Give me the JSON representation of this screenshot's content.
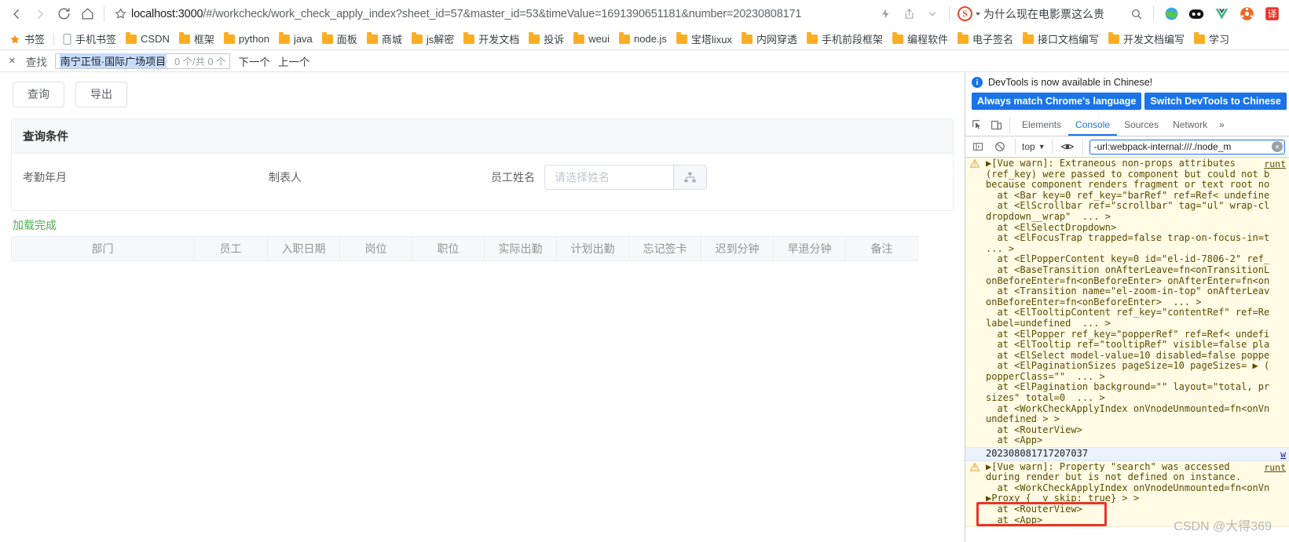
{
  "browser": {
    "url_host": "localhost:3000",
    "url_path": "/#/workcheck/work_check_apply_index?sheet_id=57&master_id=53&timeValue=1691390651181&number=20230808171",
    "search_engine_badge": "S",
    "search_query": "为什么现在电影票这么贵",
    "icons": {
      "back": "back-arrow-icon",
      "forward": "forward-arrow-icon",
      "reload": "reload-icon",
      "home": "home-icon",
      "bookmark_star": "star-icon",
      "lightning": "lightning-icon",
      "share": "share-icon",
      "chevron": "chevron-down-icon",
      "search": "search-icon"
    }
  },
  "bookmarks": {
    "star_label": "书签",
    "mobile_label": "手机书签",
    "folders": [
      "CSDN",
      "框架",
      "python",
      "java",
      "面板",
      "商城",
      "js解密",
      "开发文档",
      "投诉",
      "weui",
      "node.js",
      "宝塔lixux",
      "内网穿透",
      "手机前段框架",
      "编程软件",
      "电子签名",
      "接口文档编写",
      "开发文档编写",
      "学习"
    ]
  },
  "findbar": {
    "close": "×",
    "label": "查找",
    "value": "南宁正恒·国际广场项目",
    "count": "0 个/共 0 个",
    "next": "下一个",
    "prev": "上一个"
  },
  "page": {
    "buttons": {
      "query": "查询",
      "export": "导出"
    },
    "card_title": "查询条件",
    "fields": [
      {
        "label": "考勤年月"
      },
      {
        "label": "制表人"
      },
      {
        "label": "员工姓名",
        "placeholder": "请选择姓名"
      }
    ],
    "status": "加载完成",
    "table_headers": [
      "部门",
      "员工",
      "入职日期",
      "岗位",
      "职位",
      "实际出勤",
      "计划出勤",
      "忘记签卡",
      "迟到分钟",
      "早退分钟",
      "备注"
    ]
  },
  "devtools": {
    "banner_text": "DevTools is now available in Chinese!",
    "banner_btn_1": "Always match Chrome's language",
    "banner_btn_2": "Switch DevTools to Chinese",
    "tabs": [
      "Elements",
      "Console",
      "Sources",
      "Network"
    ],
    "active_tab": "Console",
    "overflow": "»",
    "context": "top",
    "filter_value": "-url:webpack-internal:///./node_m",
    "messages": [
      {
        "type": "warn",
        "source": "runt",
        "lines": [
          "▶[Vue warn]: Extraneous non-props attributes",
          "(ref_key) were passed to component but could not b",
          "because component renders fragment or text root no",
          "  at <Bar key=0 ref_key=\"barRef\" ref=Ref< undefine",
          "  at <ElScrollbar ref=\"scrollbar\" tag=\"ul\" wrap-cl",
          "dropdown__wrap\"  ... > ",
          "  at <ElSelectDropdown>",
          "  at <ElFocusTrap trapped=false trap-on-focus-in=t",
          "... > ",
          "  at <ElPopperContent key=0 id=\"el-id-7806-2\" ref_",
          "  at <BaseTransition onAfterLeave=fn<onTransitionL",
          "onBeforeEnter=fn<onBeforeEnter> onAfterEnter=fn<on",
          "  at <Transition name=\"el-zoom-in-top\" onAfterLeav",
          "onBeforeEnter=fn<onBeforeEnter>  ... > ",
          "  at <ElTooltipContent ref_key=\"contentRef\" ref=Re",
          "label=undefined  ... > ",
          "  at <ElPopper ref_key=\"popperRef\" ref=Ref< undefi",
          "  at <ElTooltip ref=\"tooltipRef\" visible=false pla",
          "  at <ElSelect model-value=10 disabled=false poppe",
          "  at <ElPaginationSizes pageSize=10 pageSizes= ▶ (",
          "popperClass=\"\"  ... > ",
          "  at <ElPagination background=\"\" layout=\"total, pr",
          "sizes\" total=0  ... > ",
          "  at <WorkCheckApplyIndex onVnodeUnmounted=fn<onVn",
          "undefined > > ",
          "  at <RouterView>",
          "  at <App>"
        ]
      },
      {
        "type": "log",
        "source": "w",
        "highlighted": true,
        "lines": [
          "202308081717207037"
        ]
      },
      {
        "type": "warn",
        "source": "runt",
        "lines": [
          "▶[Vue warn]: Property \"search\" was accessed",
          "during render but is not defined on instance.",
          "  at <WorkCheckApplyIndex onVnodeUnmounted=fn<onVn",
          "▶Proxy {__v_skip: true} > > ",
          "  at <RouterView>",
          "  at <App>"
        ]
      }
    ]
  },
  "watermark": "CSDN @大得369"
}
